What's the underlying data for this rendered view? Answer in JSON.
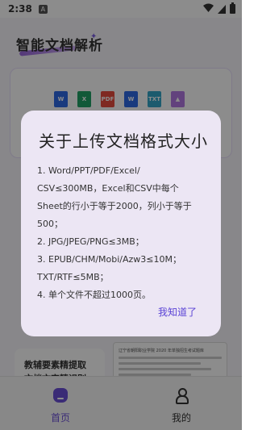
{
  "status_bar": {
    "time": "2:38",
    "a_label": "A"
  },
  "app": {
    "title": "智能文档解析",
    "file_types": [
      "W",
      "X",
      "PDF",
      "W",
      "TXT",
      "▲"
    ],
    "feature_card_text": "教辅要素精提取\n文档文字精识别",
    "doc_preview_title": "辽宁省朝阳职业学院 2020 年单独招生考试题库"
  },
  "dialog": {
    "title": "关于上传文档格式大小",
    "lines": [
      "1. Word/PPT/PDF/Excel/",
      "CSV≤300MB，Excel和CSV中每个",
      "Sheet的行小于等于2000，列小于等于",
      "500；",
      "2. JPG/JPEG/PNG≤3MB；",
      "3. EPUB/CHM/Mobi/Azw3≤10M；",
      "TXT/RTF≤5MB；",
      "4. 单个文件不超过1000页。"
    ],
    "confirm_label": "我知道了"
  },
  "bottom_nav": {
    "items": [
      {
        "label": "首页",
        "active": true
      },
      {
        "label": "我的",
        "active": false
      }
    ],
    "active_color": "#6b4fd8"
  }
}
